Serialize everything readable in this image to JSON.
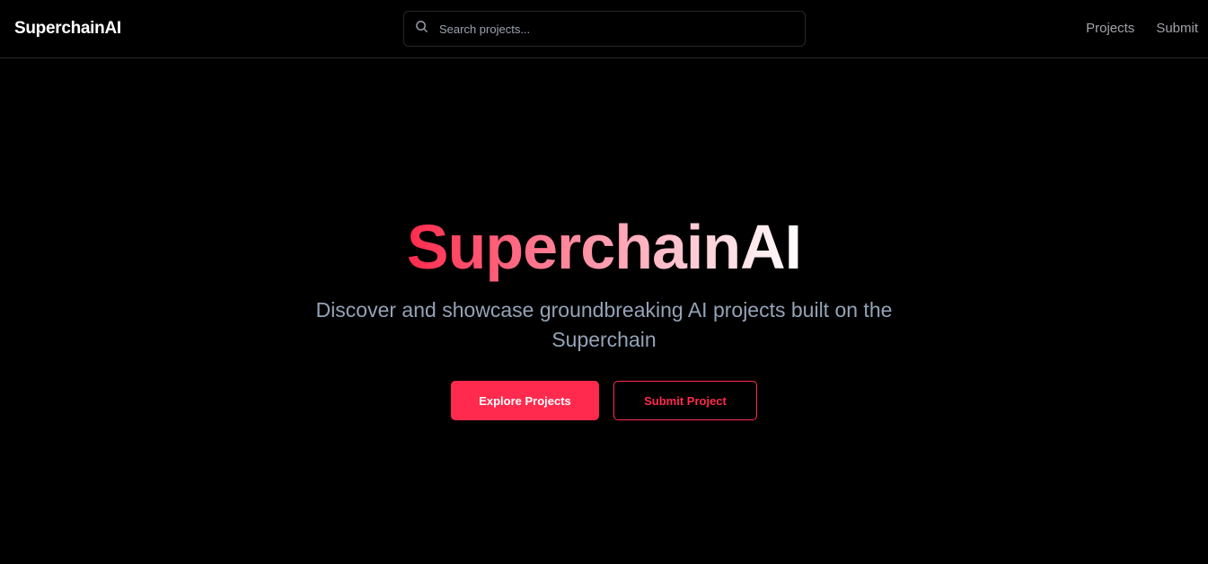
{
  "header": {
    "logo": "SuperchainAI",
    "search_placeholder": "Search projects...",
    "nav": [
      "Projects",
      "Submit"
    ]
  },
  "hero": {
    "title": "SuperchainAI",
    "subtitle": "Discover and showcase groundbreaking AI projects built on the Superchain",
    "primary_button": "Explore Projects",
    "secondary_button": "Submit Project"
  },
  "colors": {
    "accent": "#ff2a4d"
  }
}
